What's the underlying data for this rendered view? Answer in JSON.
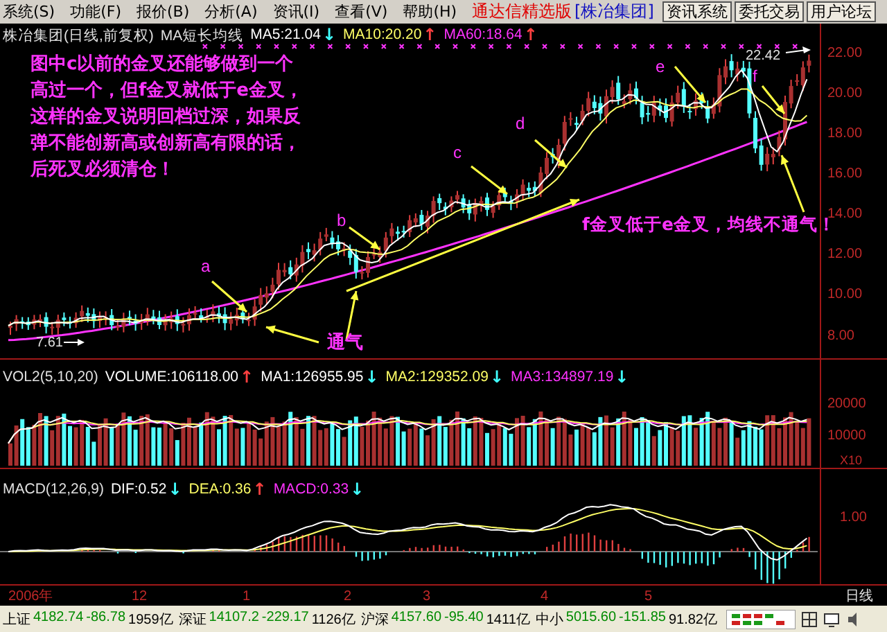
{
  "menu_bar": {
    "items": [
      "系统(S)",
      "功能(F)",
      "报价(B)",
      "分析(A)",
      "资讯(I)",
      "查看(V)",
      "帮助(H)"
    ],
    "product_name": "通达信精选版",
    "stock_tag": "[株冶集团]",
    "buttons": [
      "资讯系统",
      "委托交易",
      "用户论坛"
    ]
  },
  "price_pane": {
    "title": "株冶集团(日线,前复权)",
    "indicator": "MA短长均线",
    "values": [
      {
        "label": "MA5:21.04",
        "arrow": {
          "text": "↓",
          "color": "#40ffff"
        },
        "color": "#ffffff"
      },
      {
        "label": "MA10:20.20",
        "arrow": {
          "text": "↑",
          "color": "#ff4040"
        },
        "color": "#ffff66"
      },
      {
        "label": "MA60:18.64",
        "arrow": {
          "text": "↑",
          "color": "#ff4040"
        },
        "color": "#ff33ff"
      }
    ],
    "axis_labels": [
      "22.00",
      "20.00",
      "18.00",
      "16.00",
      "14.00",
      "12.00",
      "10.00",
      "8.00"
    ],
    "low_label": "7.61",
    "high_label": "22.42",
    "note": [
      "图中c以前的金叉还能够做到一个",
      "高过一个，但f金叉就低于e金叉，",
      "这样的金叉说明回档过深，如果反",
      "弹不能创新高或创新高有限的话，",
      "后死叉必须清仓！"
    ],
    "point_labels": [
      "a",
      "b",
      "c",
      "d",
      "e",
      "f"
    ],
    "callouts": [
      "通气",
      "f金叉低于e金叉，均线不通气！"
    ]
  },
  "volume_pane": {
    "title": "VOL2(5,10,20)",
    "values": [
      {
        "label": "VOLUME:106118.00",
        "arrow": {
          "text": "↑",
          "color": "#ff4040"
        },
        "color": "#ffffff"
      },
      {
        "label": "MA1:126955.95",
        "arrow": {
          "text": "↓",
          "color": "#40ffff"
        },
        "color": "#ffffff"
      },
      {
        "label": "MA2:129352.09",
        "arrow": {
          "text": "↓",
          "color": "#40ffff"
        },
        "color": "#ffff66"
      },
      {
        "label": "MA3:134897.19",
        "arrow": {
          "text": "↓",
          "color": "#40ffff"
        },
        "color": "#ff33ff"
      }
    ],
    "axis_labels": [
      "20000",
      "10000"
    ],
    "unit": "X10"
  },
  "macd_pane": {
    "title": "MACD(12,26,9)",
    "values": [
      {
        "label": "DIF:0.52",
        "arrow": {
          "text": "↓",
          "color": "#40ffff"
        },
        "color": "#ffffff"
      },
      {
        "label": "DEA:0.36",
        "arrow": {
          "text": "↑",
          "color": "#ff4040"
        },
        "color": "#ffff66"
      },
      {
        "label": "MACD:0.33",
        "arrow": {
          "text": "↓",
          "color": "#40ffff"
        },
        "color": "#ff33ff"
      }
    ],
    "axis_labels": [
      "1.00"
    ]
  },
  "date_axis": {
    "labels": [
      "2006年",
      "12",
      "1",
      "2",
      "3",
      "4",
      "5"
    ],
    "period": "日线"
  },
  "status_bar": {
    "indices": [
      {
        "name": "上证",
        "value": "4182.74",
        "change": "-86.78",
        "amount": "1959亿"
      },
      {
        "name": "深证",
        "value": "14107.2",
        "change": "-229.17",
        "amount": "1126亿"
      },
      {
        "name": "沪深",
        "value": "4157.60",
        "change": "-95.40",
        "amount": "1411亿"
      },
      {
        "name": "中小",
        "value": "5015.60",
        "change": "-151.85",
        "amount": "91.82亿"
      }
    ]
  }
}
